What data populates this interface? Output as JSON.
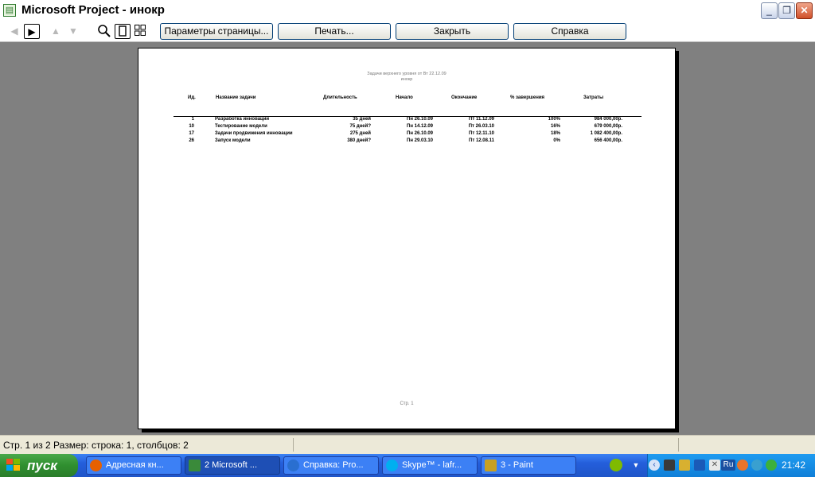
{
  "window": {
    "title": "Microsoft Project - инокр",
    "minimize": "_",
    "restore": "❐",
    "close": "✕"
  },
  "toolbar": {
    "buttons": {
      "page_setup": "Параметры страницы...",
      "print": "Печать...",
      "close": "Закрыть",
      "help": "Справка"
    }
  },
  "report": {
    "title": "Задачи верхнего уровня от Вт 22.12.09",
    "subtitle": "инокр",
    "columns": {
      "id": "Ид.",
      "name": "Название задачи",
      "duration": "Длительность",
      "start": "Начало",
      "finish": "Окончание",
      "percent": "% завершения",
      "cost": "Затраты"
    },
    "rows": [
      {
        "id": "1",
        "name": "Разработка инновации",
        "duration": "35 дней",
        "start": "Пн 26.10.09",
        "finish": "Пт 11.12.09",
        "percent": "100%",
        "cost": "984 000,00р."
      },
      {
        "id": "10",
        "name": "Тестирование модели",
        "duration": "75 дней?",
        "start": "Пн 14.12.09",
        "finish": "Пт 26.03.10",
        "percent": "16%",
        "cost": "679 000,00р."
      },
      {
        "id": "17",
        "name": "Задачи продвижения инновации",
        "duration": "275 дней",
        "start": "Пн 26.10.09",
        "finish": "Пт 12.11.10",
        "percent": "18%",
        "cost": "1 082 400,00р."
      },
      {
        "id": "26",
        "name": "Запуск модели",
        "duration": "380 дней?",
        "start": "Пн 29.03.10",
        "finish": "Пт 12.08.11",
        "percent": "0%",
        "cost": "656 400,00р."
      }
    ],
    "footer": "Стр. 1"
  },
  "statusbar": {
    "text": "Стр. 1 из 2   Размер: строка: 1, столбцов: 2"
  },
  "taskbar": {
    "start_label": "пуск",
    "tasks": [
      {
        "label": "Адресная кн...",
        "icon": "firefox-icon",
        "color": "#e66000"
      },
      {
        "label": "2 Microsoft ...",
        "icon": "ms-project-icon",
        "color": "#3a8a3a"
      },
      {
        "label": "Справка: Pro...",
        "icon": "help-icon",
        "color": "#2a6fd0"
      },
      {
        "label": "Skype™ - lafr...",
        "icon": "skype-icon",
        "color": "#00aff0"
      },
      {
        "label": "3 - Paint",
        "icon": "paint-icon",
        "color": "#c8a020"
      }
    ],
    "tray": {
      "lang": "Ru",
      "clock": "21:42"
    }
  }
}
